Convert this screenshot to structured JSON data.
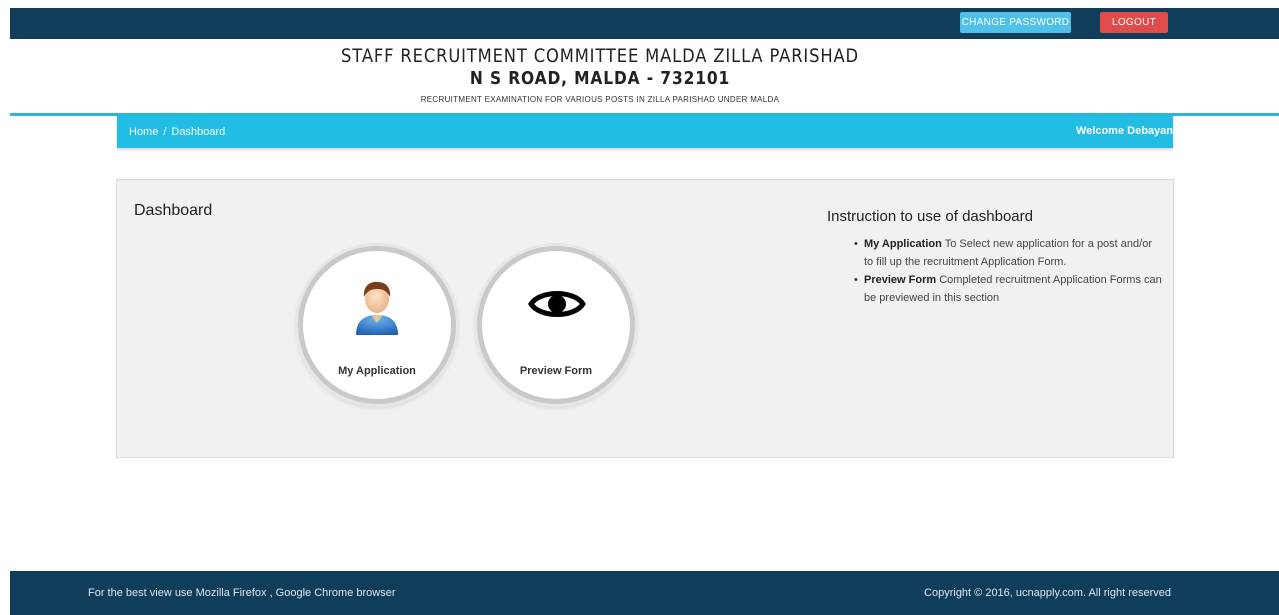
{
  "topbar": {
    "change_password": "CHANGE PASSWORD",
    "logout": "LOGOUT"
  },
  "header": {
    "title": "STAFF RECRUITMENT COMMITTEE MALDA ZILLA PARISHAD",
    "address": "N S ROAD, MALDA - 732101",
    "subtitle": "RECRUITMENT EXAMINATION FOR VARIOUS POSTS IN ZILLA PARISHAD UNDER MALDA"
  },
  "breadcrumb": {
    "home": "Home",
    "separator": "/",
    "current": "Dashboard",
    "welcome": "Welcome Debayan"
  },
  "dashboard": {
    "title": "Dashboard",
    "tiles": [
      {
        "label": "My Application",
        "icon": "user-icon"
      },
      {
        "label": "Preview Form",
        "icon": "eye-icon"
      }
    ],
    "instructions": {
      "title": "Instruction to use of dashboard",
      "items": [
        {
          "term": "My Application",
          "text": "To Select new application for a post and/or to fill up the recruitment Application Form."
        },
        {
          "term": "Preview Form",
          "text": "Completed recruitment Application Forms can be previewed in this section"
        }
      ]
    }
  },
  "footer": {
    "left": "For the best view use Mozilla Firefox , Google Chrome browser",
    "right": "Copyright © 2016, ucnapply.com. All right reserved"
  },
  "colors": {
    "topbar": "#0f3d5a",
    "accent": "#21bde4",
    "logout": "#e04b4b",
    "change_password": "#4fc1e9"
  }
}
